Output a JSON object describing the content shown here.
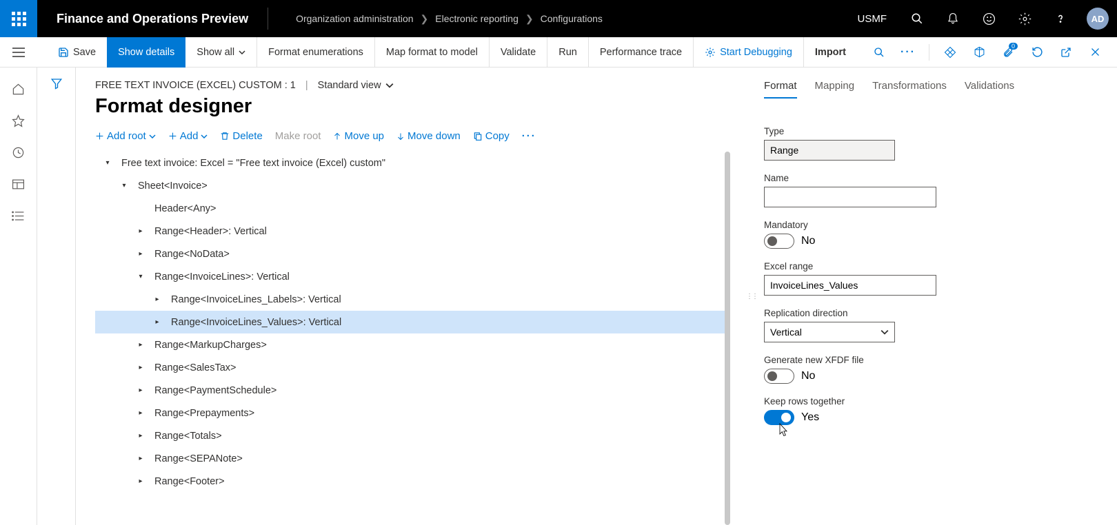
{
  "header": {
    "app_title": "Finance and Operations Preview",
    "breadcrumb": [
      "Organization administration",
      "Electronic reporting",
      "Configurations"
    ],
    "company": "USMF",
    "avatar": "AD"
  },
  "action_bar": {
    "save": "Save",
    "show_details": "Show details",
    "show_all": "Show all",
    "format_enum": "Format enumerations",
    "map_format": "Map format to model",
    "validate": "Validate",
    "run": "Run",
    "perf_trace": "Performance trace",
    "start_debug": "Start Debugging",
    "import": "Import",
    "badge": "0"
  },
  "page": {
    "context": "FREE TEXT INVOICE (EXCEL) CUSTOM : 1",
    "view": "Standard view",
    "title": "Format designer"
  },
  "toolbar": {
    "add_root": "Add root",
    "add": "Add",
    "delete": "Delete",
    "make_root": "Make root",
    "move_up": "Move up",
    "move_down": "Move down",
    "copy": "Copy"
  },
  "tree": [
    {
      "label": "Free text invoice: Excel = \"Free text invoice (Excel) custom\"",
      "indent": 0,
      "expanded": true
    },
    {
      "label": "Sheet<Invoice>",
      "indent": 1,
      "expanded": true
    },
    {
      "label": "Header<Any>",
      "indent": 2,
      "leaf": true
    },
    {
      "label": "Range<Header>: Vertical",
      "indent": 2,
      "collapsed": true
    },
    {
      "label": "Range<NoData>",
      "indent": 2,
      "collapsed": true
    },
    {
      "label": "Range<InvoiceLines>: Vertical",
      "indent": 2,
      "expanded": true
    },
    {
      "label": "Range<InvoiceLines_Labels>: Vertical",
      "indent": 3,
      "collapsed": true
    },
    {
      "label": "Range<InvoiceLines_Values>: Vertical",
      "indent": 3,
      "collapsed": true,
      "selected": true
    },
    {
      "label": "Range<MarkupCharges>",
      "indent": 2,
      "collapsed": true
    },
    {
      "label": "Range<SalesTax>",
      "indent": 2,
      "collapsed": true
    },
    {
      "label": "Range<PaymentSchedule>",
      "indent": 2,
      "collapsed": true
    },
    {
      "label": "Range<Prepayments>",
      "indent": 2,
      "collapsed": true
    },
    {
      "label": "Range<Totals>",
      "indent": 2,
      "collapsed": true
    },
    {
      "label": "Range<SEPANote>",
      "indent": 2,
      "collapsed": true
    },
    {
      "label": "Range<Footer>",
      "indent": 2,
      "collapsed": true
    }
  ],
  "tabs": [
    "Format",
    "Mapping",
    "Transformations",
    "Validations"
  ],
  "form": {
    "type_label": "Type",
    "type_value": "Range",
    "name_label": "Name",
    "name_value": "",
    "mandatory_label": "Mandatory",
    "mandatory_value": "No",
    "excel_range_label": "Excel range",
    "excel_range_value": "InvoiceLines_Values",
    "replication_label": "Replication direction",
    "replication_value": "Vertical",
    "xfdf_label": "Generate new XFDF file",
    "xfdf_value": "No",
    "keep_rows_label": "Keep rows together",
    "keep_rows_value": "Yes"
  }
}
